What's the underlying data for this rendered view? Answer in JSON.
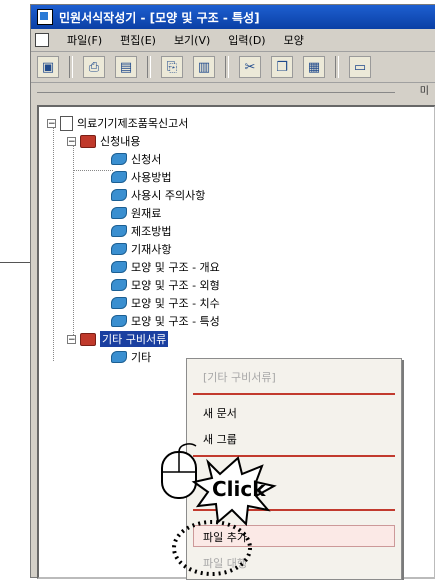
{
  "window": {
    "title": "민원서식작성기 - [모양 및 구조 - 특성]"
  },
  "menubar": {
    "items": [
      {
        "label": "파일(F)"
      },
      {
        "label": "편집(E)"
      },
      {
        "label": "보기(V)"
      },
      {
        "label": "입력(D)"
      },
      {
        "label": "모양"
      }
    ]
  },
  "toolbar": {
    "buttons": [
      {
        "icon": "window-icon"
      },
      {
        "icon": "print-icon"
      },
      {
        "icon": "save-icon"
      },
      {
        "icon": "print-preview-icon"
      },
      {
        "icon": "document-icon"
      },
      {
        "icon": "cut-icon"
      },
      {
        "icon": "copy-icon"
      },
      {
        "icon": "paste-icon"
      },
      {
        "icon": "new-folder-icon"
      }
    ]
  },
  "subbar": {
    "label": "미"
  },
  "tree": {
    "root": "의료기기제조품목신고서",
    "group1": "신청내용",
    "children": [
      "신청서",
      "사용방법",
      "사용시 주의사항",
      "원재료",
      "제조방법",
      "기재사항",
      "모양 및 구조 - 개요",
      "모양 및 구조 - 외형",
      "모양 및 구조 - 치수",
      "모양 및 구조 - 특성"
    ],
    "group2": "기타 구비서류",
    "group2_child": "기타"
  },
  "context_menu": {
    "header": "[기타 구비서류]",
    "items": [
      {
        "label": "새 문서"
      },
      {
        "label": "새 그룹"
      },
      {
        "label": "파일 추가"
      },
      {
        "label": "파일 대행"
      }
    ]
  },
  "overlay": {
    "click_label": "Click"
  }
}
